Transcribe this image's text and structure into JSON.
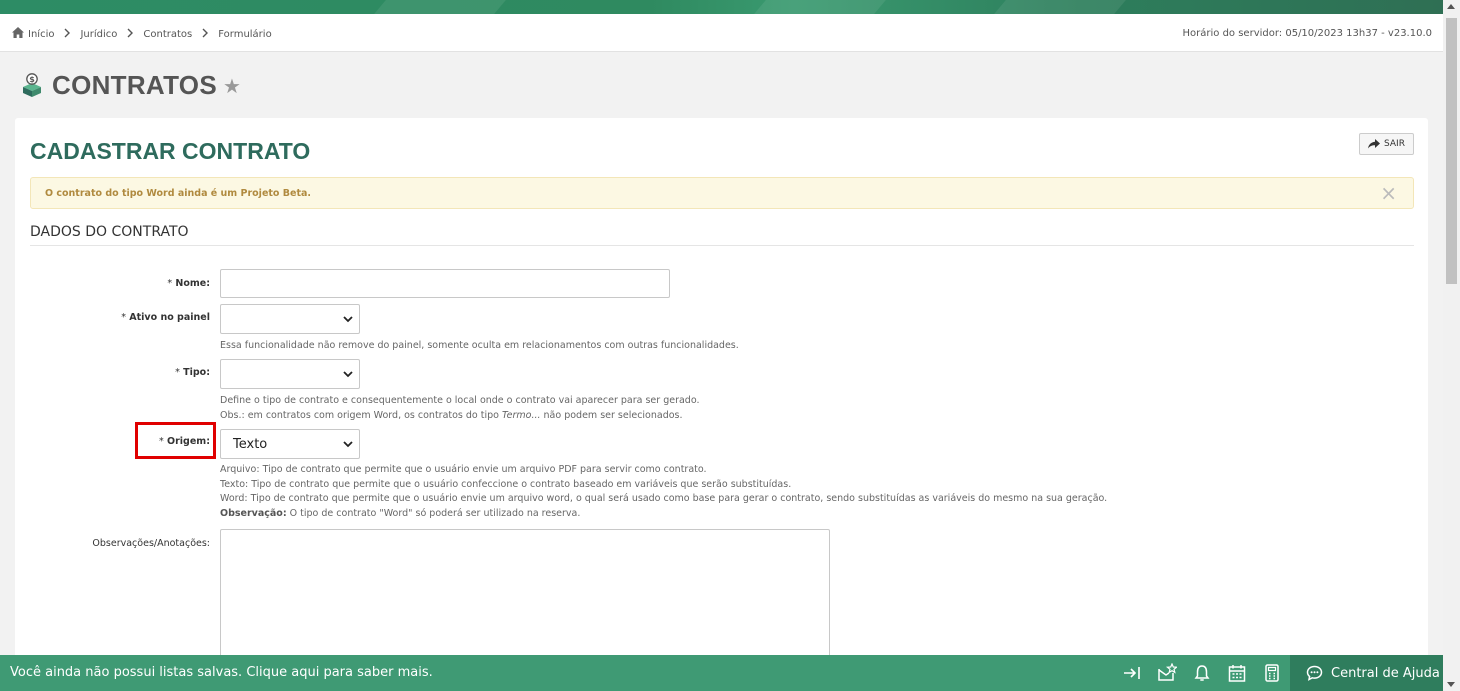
{
  "breadcrumb": {
    "items": [
      "Início",
      "Jurídico",
      "Contratos",
      "Formulário"
    ]
  },
  "server_time": "Horário do servidor: 05/10/2023 13h37 - v23.10.0",
  "page": {
    "title": "CONTRATOS"
  },
  "card": {
    "title": "CADASTRAR CONTRATO",
    "exit_label": "SAIR",
    "alert_text": "O contrato do tipo Word ainda é um Projeto Beta.",
    "section_title": "DADOS DO CONTRATO"
  },
  "form": {
    "nome": {
      "label": "Nome:",
      "required": "*",
      "value": ""
    },
    "ativo": {
      "label": "Ativo no painel",
      "required": "*",
      "value": "",
      "help": "Essa funcionalidade não remove do painel, somente oculta em relacionamentos com outras funcionalidades."
    },
    "tipo": {
      "label": "Tipo:",
      "required": "*",
      "value": "",
      "help1": "Define o tipo de contrato e consequentemente o local onde o contrato vai aparecer para ser gerado.",
      "help2_prefix": "Obs.: em contratos com origem Word, os contratos do tipo ",
      "help2_em": "Termo...",
      "help2_suffix": " não podem ser selecionados."
    },
    "origem": {
      "label": "Origem:",
      "required": "*",
      "value": "Texto",
      "help_arquivo": "Arquivo: Tipo de contrato que permite que o usuário envie um arquivo PDF para servir como contrato.",
      "help_texto": "Texto: Tipo de contrato que permite que o usuário confeccione o contrato baseado em variáveis que serão substituídas.",
      "help_word": "Word: Tipo de contrato que permite que o usuário envie um arquivo word, o qual será usado como base para gerar o contrato, sendo substituídas as variáveis do mesmo na sua geração.",
      "help_obs_label": "Observação:",
      "help_obs": " O tipo de contrato \"Word\" só poderá ser utilizado na reserva."
    },
    "observacoes": {
      "label": "Observações/Anotações:",
      "value": ""
    }
  },
  "footer": {
    "message": "Você ainda não possui listas salvas. Clique aqui para saber mais.",
    "help_center": "Central de Ajuda"
  },
  "colors": {
    "brand_green": "#3f9a74",
    "title_green": "#2e6b5d",
    "highlight_red": "#e00000",
    "alert_bg": "#fcf8e3"
  },
  "icons": [
    "home-icon",
    "chevron-right-icon",
    "money-box-icon",
    "star-icon",
    "share-arrow-icon",
    "close-icon",
    "chevron-down-icon",
    "collapse-right-icon",
    "envelope-star-icon",
    "bell-icon",
    "calendar-icon",
    "calculator-icon",
    "chat-icon"
  ]
}
